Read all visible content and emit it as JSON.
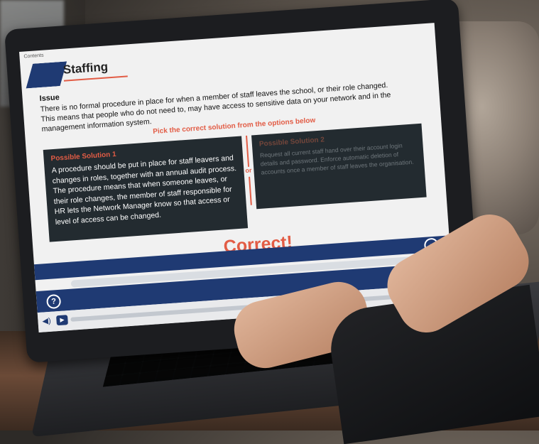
{
  "screen": {
    "contents_link": "Contents",
    "title": "Staffing",
    "issue": {
      "label": "Issue",
      "text": "There is no formal procedure in place for when a member of staff leaves the school, or their role changed. This means that people who do not need to, may have access to sensitive data on your network and in the management information system."
    },
    "prompt": "Pick the correct solution from the options below",
    "solutions": [
      {
        "heading": "Possible Solution 1",
        "text": "A procedure should be put in place for staff leavers and changes in roles, together with an annual audit process. The procedure means that when someone leaves, or their role changes, the member of staff responsible for HR lets the Network Manager know so that access or level of access can be changed."
      },
      {
        "heading": "Possible Solution 2",
        "text": "Request all current staff hand over their account login details and password. Enforce automatic deletion of accounts once a member of staff leaves the organisation."
      }
    ],
    "or_label": "or",
    "feedback": "Correct!",
    "icons": {
      "next": "chevron-right-circle-icon",
      "help": "question-circle-icon",
      "reload": "reload-icon",
      "play": "play-icon",
      "volume": "volume-icon"
    },
    "help_label": "?",
    "next_label": "›",
    "colors": {
      "brand_blue": "#1f3a73",
      "accent_red": "#e25c45",
      "panel_dark": "#232b30"
    }
  }
}
